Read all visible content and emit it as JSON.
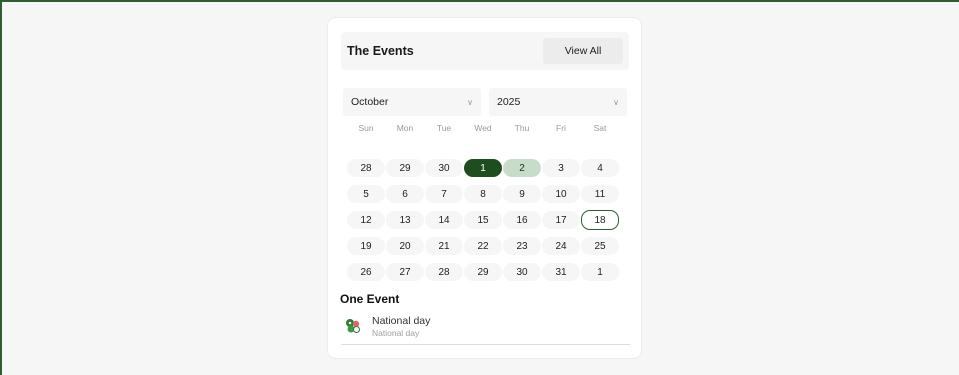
{
  "widget": {
    "title": "The Events",
    "view_all_label": "View All"
  },
  "selects": {
    "month": "October",
    "year": "2025"
  },
  "weekdays": [
    "Sun",
    "Mon",
    "Tue",
    "Wed",
    "Thu",
    "Fri",
    "Sat"
  ],
  "weeks": [
    [
      "28",
      "29",
      "30",
      "1",
      "2",
      "3",
      "4"
    ],
    [
      "5",
      "6",
      "7",
      "8",
      "9",
      "10",
      "11"
    ],
    [
      "12",
      "13",
      "14",
      "15",
      "16",
      "17",
      "18"
    ],
    [
      "19",
      "20",
      "21",
      "22",
      "23",
      "24",
      "25"
    ],
    [
      "26",
      "27",
      "28",
      "29",
      "30",
      "31",
      "1"
    ]
  ],
  "selected_day": "1",
  "range_end_day": "2",
  "today_day": "18",
  "events_heading": "One Event",
  "events": [
    {
      "title": "National day",
      "subtitle": "National day",
      "icon": "national-day-icon"
    }
  ],
  "colors": {
    "selected": "#1e4d1f",
    "range": "#c8ddc9",
    "today_border": "#2f5e32"
  }
}
